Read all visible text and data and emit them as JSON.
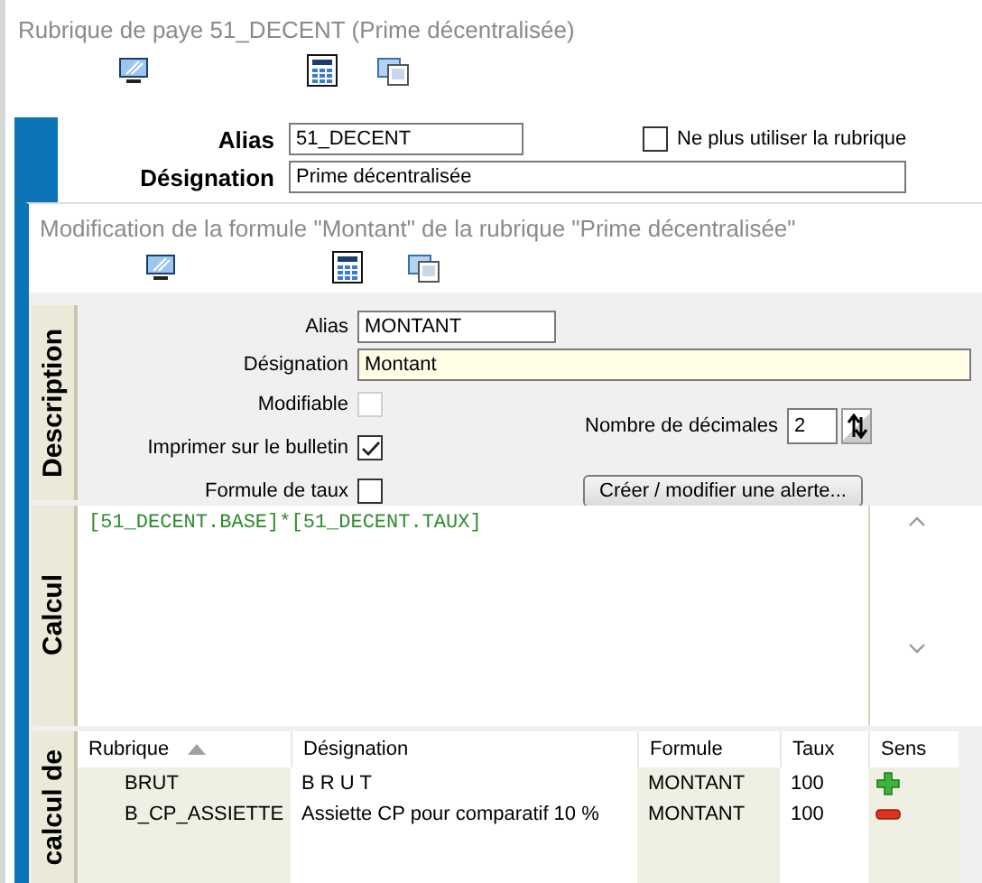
{
  "background_window": {
    "title": "Rubrique de paye 51_DECENT (Prime décentralisée)",
    "alias_label": "Alias",
    "alias": "51_DECENT",
    "disable_option": {
      "label": "Ne plus utiliser la rubrique",
      "checked": false
    },
    "designation_label": "Désignation",
    "designation": "Prime décentralisée"
  },
  "dialog": {
    "title": "Modification de la formule \"Montant\" de la rubrique \"Prime décentralisée\"",
    "tabs": [
      {
        "label": "Description"
      },
      {
        "label": "Calcul"
      },
      {
        "label": "calcul de"
      }
    ],
    "alias_label": "Alias",
    "alias": "MONTANT",
    "designation_label": "Désignation",
    "designation": "Montant",
    "options": [
      {
        "label": "Modifiable",
        "checked": false,
        "disabled": true
      },
      {
        "label": "Imprimer sur le bulletin",
        "checked": true,
        "disabled": false
      },
      {
        "label": "Formule de taux",
        "checked": false,
        "disabled": false
      }
    ],
    "decimals_label": "Nombre de décimales",
    "decimals": "2",
    "alert_button": "Créer / modifier une alerte...",
    "formula": "[51_DECENT.BASE]*[51_DECENT.TAUX]",
    "table": {
      "columns": [
        {
          "label": "Rubrique",
          "sorted": true
        },
        {
          "label": "Désignation",
          "sorted": false
        },
        {
          "label": "Formule",
          "sorted": false
        },
        {
          "label": "Taux",
          "sorted": false
        },
        {
          "label": "Sens",
          "sorted": false
        }
      ],
      "rows": [
        {
          "rubrique": "BRUT",
          "designation": "B R U T",
          "formule": "MONTANT",
          "taux": "100",
          "kind": "plus"
        },
        {
          "rubrique": "B_CP_ASSIETTE",
          "designation": "Assiette CP pour comparatif  10 %",
          "formule": "MONTANT",
          "taux": "100",
          "kind": "minus"
        }
      ]
    }
  }
}
